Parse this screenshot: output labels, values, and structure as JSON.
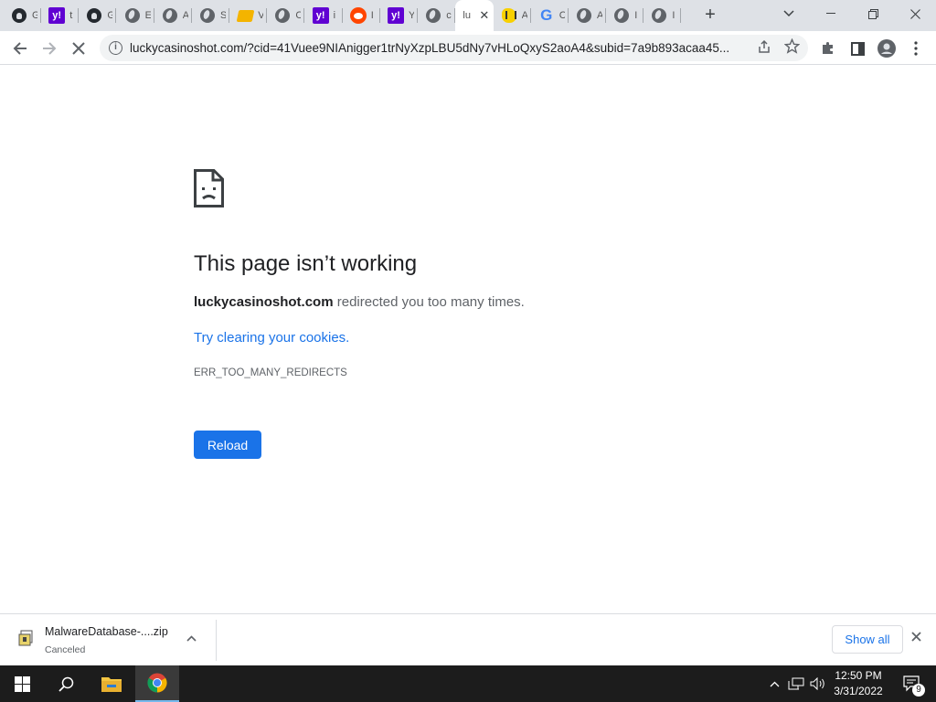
{
  "browser": {
    "tabs": [
      {
        "icon": "github-icon",
        "title": "G"
      },
      {
        "icon": "yahoo-icon",
        "title": "t"
      },
      {
        "icon": "github-icon",
        "title": "G"
      },
      {
        "icon": "globe-icon",
        "title": "E"
      },
      {
        "icon": "globe-icon",
        "title": "A"
      },
      {
        "icon": "globe-icon",
        "title": "S"
      },
      {
        "icon": "folder-icon",
        "title": "V"
      },
      {
        "icon": "globe-icon",
        "title": "C"
      },
      {
        "icon": "yahoo-icon",
        "title": "i"
      },
      {
        "icon": "reddit-icon",
        "title": "I"
      },
      {
        "icon": "yahoo-icon",
        "title": "Y"
      },
      {
        "icon": "globe-icon",
        "title": "c"
      },
      {
        "icon": "active-tab-text",
        "title": "lu"
      },
      {
        "icon": "bee-icon",
        "title": "A"
      },
      {
        "icon": "google-icon",
        "title": "C"
      },
      {
        "icon": "globe-icon",
        "title": "A"
      },
      {
        "icon": "globe-icon",
        "title": "I"
      },
      {
        "icon": "globe-icon",
        "title": "I"
      }
    ],
    "active_tab_index": 12,
    "address": {
      "url": "luckycasinoshot.com/?cid=41Vuee9NIAnigger1trNyXzpLBU5dNy7vHLoQxyS2aoA4&subid=7a9b893acaa45..."
    }
  },
  "error_page": {
    "title": "This page isn’t working",
    "domain": "luckycasinoshot.com",
    "description_suffix": " redirected you too many times.",
    "link": "Try clearing your cookies.",
    "code": "ERR_TOO_MANY_REDIRECTS",
    "reload_label": "Reload"
  },
  "download_shelf": {
    "file_name": "MalwareDatabase-....zip",
    "status": "Canceled",
    "show_all_label": "Show all"
  },
  "taskbar": {
    "time": "12:50 PM",
    "date": "3/31/2022",
    "notification_count": "9"
  },
  "colors": {
    "accent": "#1a73e8",
    "tabstrip": "#dee1e6",
    "taskbar": "#1c1c1c"
  }
}
